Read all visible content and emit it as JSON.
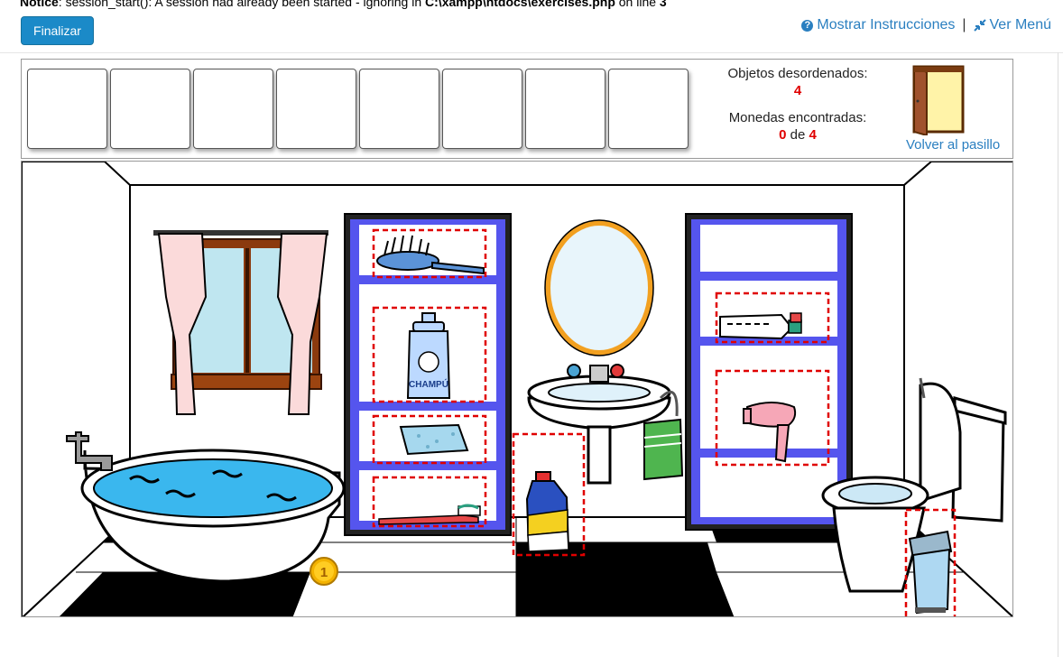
{
  "notice": {
    "label": "Notice",
    "message": ": session_start(): A session had already been started - ignoring in ",
    "path": "C:\\xampp\\htdocs\\exercises.php",
    "line_text": " on line ",
    "line": "3"
  },
  "toolbar": {
    "finalizar": "Finalizar",
    "instrucciones": "Mostrar Instrucciones",
    "separator": "|",
    "menu": "Ver Menú"
  },
  "status": {
    "objetos_label": "Objetos desordenados:",
    "objetos_value": "4",
    "monedas_label": "Monedas encontradas:",
    "monedas_found": "0",
    "monedas_de": "de",
    "monedas_total": "4"
  },
  "nav": {
    "volver": "Volver al pasillo"
  },
  "scene": {
    "shampoo_label": "CHAMPÚ",
    "coin_label": "1"
  },
  "colors": {
    "link": "#2a7fc0",
    "button": "#1b8ac8",
    "highlight": "#e00000",
    "shelf": "#5555ee",
    "water": "#3ab7ee"
  }
}
